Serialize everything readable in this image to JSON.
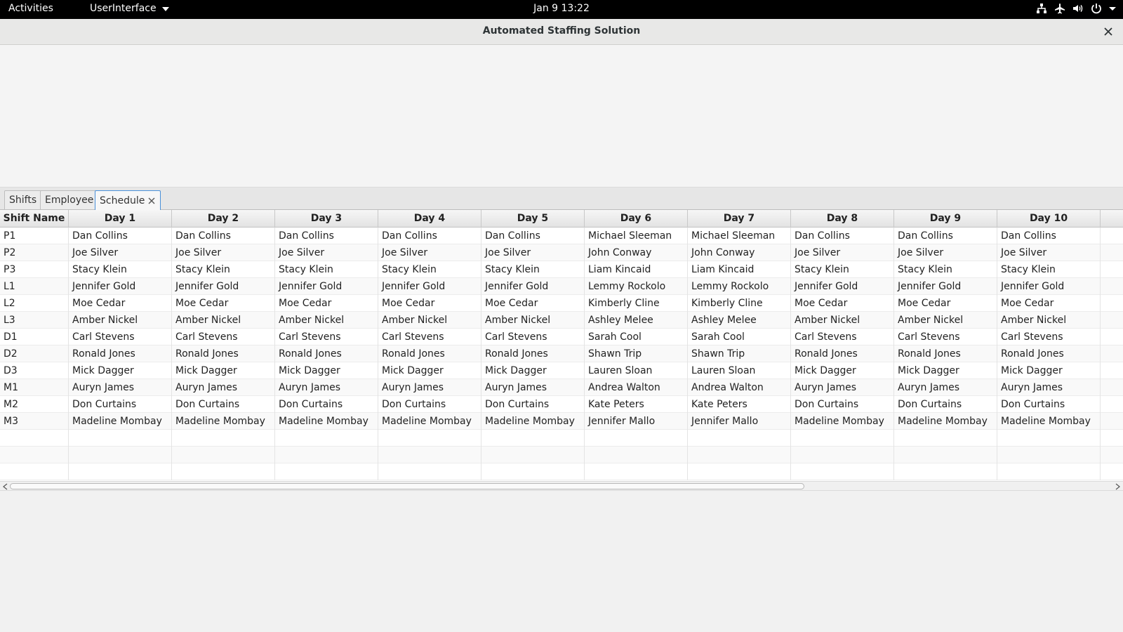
{
  "topbar": {
    "activities": "Activities",
    "app_menu": "UserInterface",
    "clock": "Jan 9  13:22",
    "tray_icons": [
      "network-icon",
      "airplane-mode-icon",
      "volume-icon",
      "power-icon"
    ]
  },
  "window": {
    "title": "Automated Staffing Solution"
  },
  "tabs": [
    {
      "label": "Shifts",
      "active": false
    },
    {
      "label": "Employee",
      "active": false
    },
    {
      "label": "Schedule",
      "active": true,
      "closable": true
    }
  ],
  "table": {
    "columns": [
      "Shift Name",
      "Day 1",
      "Day 2",
      "Day 3",
      "Day 4",
      "Day 5",
      "Day 6",
      "Day 7",
      "Day 8",
      "Day 9",
      "Day 10"
    ],
    "rows": [
      [
        "P1",
        "Dan Collins",
        "Dan Collins",
        "Dan Collins",
        "Dan Collins",
        "Dan Collins",
        "Michael Sleeman",
        "Michael Sleeman",
        "Dan Collins",
        "Dan Collins",
        "Dan Collins"
      ],
      [
        "P2",
        "Joe Silver",
        "Joe Silver",
        "Joe Silver",
        "Joe Silver",
        "Joe Silver",
        "John Conway",
        "John Conway",
        "Joe Silver",
        "Joe Silver",
        "Joe Silver"
      ],
      [
        "P3",
        "Stacy Klein",
        "Stacy Klein",
        "Stacy Klein",
        "Stacy Klein",
        "Stacy Klein",
        "Liam Kincaid",
        "Liam Kincaid",
        "Stacy Klein",
        "Stacy Klein",
        "Stacy Klein"
      ],
      [
        "L1",
        "Jennifer Gold",
        "Jennifer Gold",
        "Jennifer Gold",
        "Jennifer Gold",
        "Jennifer Gold",
        "Lemmy Rockolo",
        "Lemmy Rockolo",
        "Jennifer Gold",
        "Jennifer Gold",
        "Jennifer Gold"
      ],
      [
        "L2",
        "Moe Cedar",
        "Moe Cedar",
        "Moe Cedar",
        "Moe Cedar",
        "Moe Cedar",
        "Kimberly Cline",
        "Kimberly Cline",
        "Moe Cedar",
        "Moe Cedar",
        "Moe Cedar"
      ],
      [
        "L3",
        "Amber Nickel",
        "Amber Nickel",
        "Amber Nickel",
        "Amber Nickel",
        "Amber Nickel",
        "Ashley Melee",
        "Ashley Melee",
        "Amber Nickel",
        "Amber Nickel",
        "Amber Nickel"
      ],
      [
        "D1",
        "Carl Stevens",
        "Carl Stevens",
        "Carl Stevens",
        "Carl Stevens",
        "Carl Stevens",
        "Sarah Cool",
        "Sarah Cool",
        "Carl Stevens",
        "Carl Stevens",
        "Carl Stevens"
      ],
      [
        "D2",
        "Ronald Jones",
        "Ronald Jones",
        "Ronald Jones",
        "Ronald Jones",
        "Ronald Jones",
        "Shawn Trip",
        "Shawn Trip",
        "Ronald Jones",
        "Ronald Jones",
        "Ronald Jones"
      ],
      [
        "D3",
        "Mick Dagger",
        "Mick Dagger",
        "Mick Dagger",
        "Mick Dagger",
        "Mick Dagger",
        "Lauren Sloan",
        "Lauren Sloan",
        "Mick Dagger",
        "Mick Dagger",
        "Mick Dagger"
      ],
      [
        "M1",
        "Auryn James",
        "Auryn James",
        "Auryn James",
        "Auryn James",
        "Auryn James",
        "Andrea Walton",
        "Andrea Walton",
        "Auryn James",
        "Auryn James",
        "Auryn James"
      ],
      [
        "M2",
        "Don Curtains",
        "Don Curtains",
        "Don Curtains",
        "Don Curtains",
        "Don Curtains",
        "Kate Peters",
        "Kate Peters",
        "Don Curtains",
        "Don Curtains",
        "Don Curtains"
      ],
      [
        "M3",
        "Madeline Mombay",
        "Madeline Mombay",
        "Madeline Mombay",
        "Madeline Mombay",
        "Madeline Mombay",
        "Jennifer Mallo",
        "Jennifer Mallo",
        "Madeline Mombay",
        "Madeline Mombay",
        "Madeline Mombay"
      ]
    ],
    "empty_rows": 3
  },
  "scrollbar": {
    "horizontal_visible_fraction": 0.72
  },
  "colors": {
    "topbar_bg": "#000000",
    "active_tab_border": "#4a90d9",
    "window_bg": "#f1f1f1"
  }
}
